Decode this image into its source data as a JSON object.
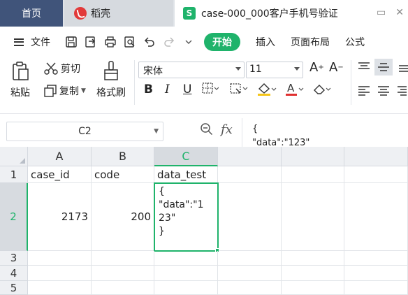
{
  "tabs": {
    "home": "首页",
    "daoke": "稻壳",
    "file": "case-000_000客户手机号验证"
  },
  "menu": {
    "file_label": "文件",
    "start": "开始",
    "insert": "插入",
    "page_layout": "页面布局",
    "formulas": "公式"
  },
  "ribbon": {
    "paste": "粘贴",
    "cut": "剪切",
    "copy": "复制",
    "format_painter": "格式刷",
    "font_name": "宋体",
    "font_size": "11"
  },
  "formula_bar": {
    "cell_ref": "C2",
    "fx_label": "fx",
    "content": "{\n\"data\":\"123\"\n}"
  },
  "grid": {
    "columns": [
      "A",
      "B",
      "C"
    ],
    "rows": [
      "1",
      "2",
      "3",
      "4",
      "5"
    ],
    "header_row": [
      "case_id",
      "code",
      "data_test"
    ],
    "row2": {
      "case_id": "2173",
      "code": "200",
      "data_test": "{\n\"data\":\"1\n23\"\n}"
    }
  },
  "colors": {
    "accent": "#1fb36b",
    "home_tab": "#40547a"
  }
}
